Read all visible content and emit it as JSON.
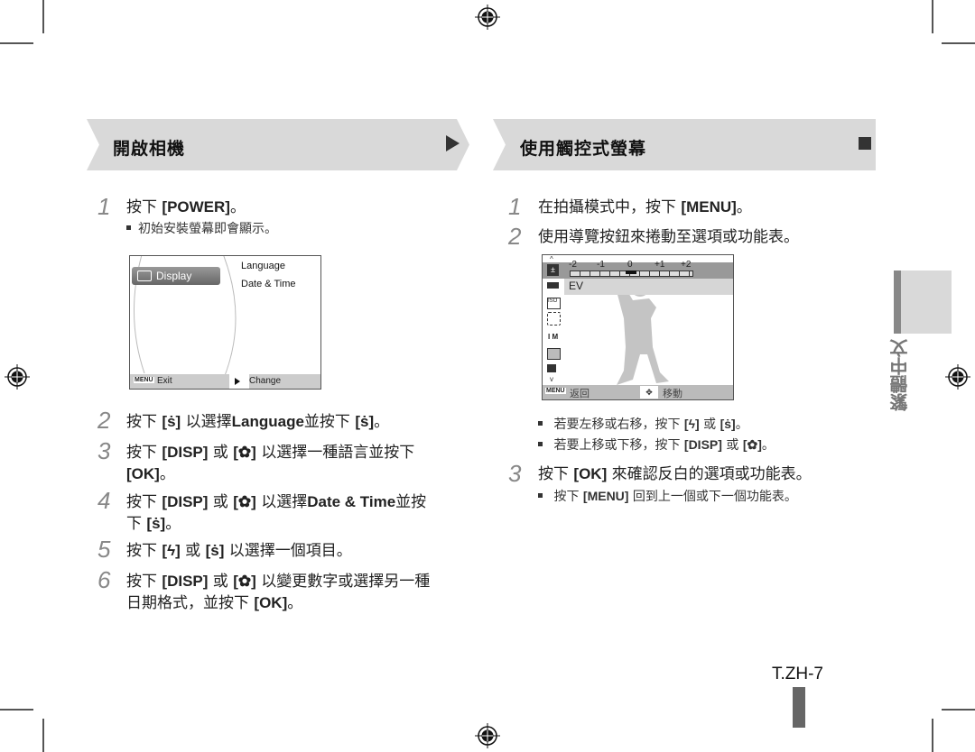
{
  "left_section": {
    "title": "開啟相機",
    "steps": [
      {
        "num": "1",
        "pre": "按下 ",
        "key": "[POWER]",
        "post": "。"
      },
      {
        "num": "2",
        "parts": [
          "按下 ",
          "[",
          "⏲",
          "]",
          " 以選擇",
          "Language",
          "並按下 ",
          "[",
          "⏲",
          "]",
          "。"
        ]
      },
      {
        "num": "3",
        "line1": "按下 [DISP] 或 [✿] 以選擇一種語言並按下",
        "line2": "[OK]。"
      },
      {
        "num": "4",
        "line1": "按下 [DISP] 或 [✿] 以選擇Date & Time並按",
        "line2": "下 [⏲]。"
      },
      {
        "num": "5",
        "line1": "按下 [ϟ] 或 [⏲] 以選擇一個項目。"
      },
      {
        "num": "6",
        "line1": "按下 [DISP] 或 [✿] 以變更數字或選擇另一種",
        "line2": "日期格式，並按下 [OK]。"
      }
    ],
    "step1_bullet": "初始安裝螢幕即會顯示。",
    "step2": {
      "pre": "按下 ",
      "mid": " 以選擇",
      "word": "Language",
      "post_a": "並按下 ",
      "end": "。"
    },
    "step3": {
      "pre": "按下 ",
      "key1": "[DISP]",
      "or": " 或 ",
      "post": " 以選擇一種語言並按下",
      "key2": "[OK]",
      "end": "。"
    },
    "step4": {
      "pre": "按下 ",
      "key1": "[DISP]",
      "or": " 或 ",
      "mid": " 以選擇",
      "word": "Date & Time",
      "post": "並按",
      "line2pre": "下 ",
      "end": "。"
    },
    "step5": {
      "pre": "按下 ",
      "or": " 或 ",
      "post": " 以選擇一個項目。"
    },
    "step6": {
      "pre": "按下 ",
      "key1": "[DISP]",
      "or": " 或 ",
      "post": " 以變更數字或選擇另一種",
      "line2": "日期格式，並按下 ",
      "key2": "[OK]",
      "end": "。"
    },
    "screen": {
      "menu_item": "Display",
      "options": [
        "Language",
        "Date & Time"
      ],
      "footer_left_key": "MENU",
      "footer_left": "Exit",
      "footer_right": "Change"
    }
  },
  "right_section": {
    "title": "使用觸控式螢幕",
    "step1": {
      "pre": "在拍攝模式中，按下 ",
      "key": "[MENU]",
      "end": "。"
    },
    "step2": "使用導覽按鈕來捲動至選項或功能表。",
    "bullet1": {
      "pre": "若要左移或右移，按下 ",
      "or": " 或 ",
      "end": "。"
    },
    "bullet2": {
      "pre": "若要上移或下移，按下 ",
      "key": "[DISP]",
      "or": " 或 ",
      "end": "。"
    },
    "step3": {
      "pre": "按下 ",
      "key": "[OK]",
      "post": " 來確認反白的選項或功能表。"
    },
    "step3_bullet": {
      "pre": "按下 ",
      "key": "[MENU]",
      "post": " 回到上一個或下一個功能表。"
    },
    "screen": {
      "ev_scale": [
        "-2",
        "-1",
        "0",
        "+1",
        "+2"
      ],
      "ev_value": 0,
      "selected_label": "EV",
      "side_icons": [
        "ev-icon",
        "awb-icon",
        "iso-icon",
        "face-detect-off-icon",
        "size-icon",
        "quality-icon",
        "flash-off-icon"
      ],
      "footer_left_key": "MENU",
      "footer_left": "返回",
      "footer_right": "移動"
    }
  },
  "side_tab": {
    "label": "繁體中文"
  },
  "page_number": "T.ZH-7",
  "step_numbers": {
    "s1": "1",
    "s2": "2",
    "s3": "3",
    "s4": "4",
    "s5": "5",
    "s6": "6"
  },
  "glyphs": {
    "timer": "ṡ",
    "macro": "✿",
    "flash": "ϟ",
    "open": "[",
    "close": "]"
  }
}
